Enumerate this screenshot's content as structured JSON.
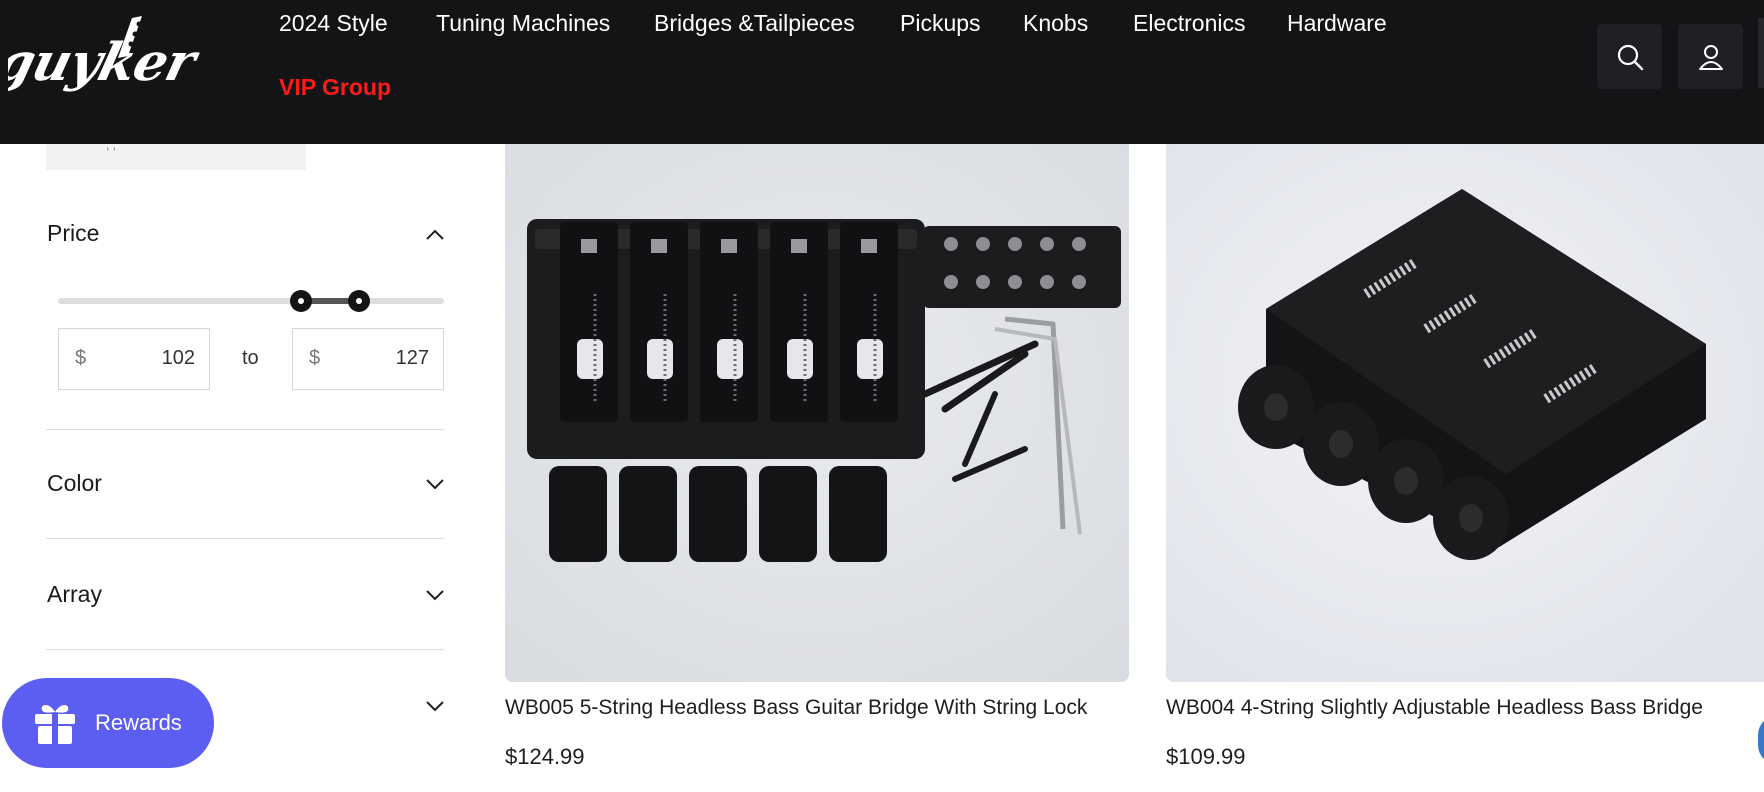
{
  "brand": {
    "logo_text": "guyker"
  },
  "nav": {
    "items": [
      {
        "label": "2024 Style"
      },
      {
        "label": "Tuning Machines"
      },
      {
        "label": "Bridges &Tailpieces"
      },
      {
        "label": "Pickups"
      },
      {
        "label": "Knobs"
      },
      {
        "label": "Electronics"
      },
      {
        "label": "Hardware"
      },
      {
        "label": "VIP Group"
      }
    ],
    "vip_color": "#ff1a1a"
  },
  "header_icons": {
    "search": "search-icon",
    "account": "user-icon"
  },
  "filters": {
    "price": {
      "title": "Price",
      "currency": "$",
      "min": "102",
      "max": "127",
      "to_label": "to",
      "range_low_fraction": 0.63,
      "range_high_fraction": 0.78
    },
    "facets": [
      {
        "title": "Color"
      },
      {
        "title": "Array"
      }
    ]
  },
  "rewards": {
    "label": "Rewards",
    "color": "#5b5ef0"
  },
  "products": [
    {
      "title": "WB005 5-String Headless Bass Guitar Bridge With String Lock",
      "price": "$124.99"
    },
    {
      "title": "WB004 4-String Slightly Adjustable Headless Bass Bridge",
      "price": "$109.99"
    }
  ],
  "colors": {
    "header_bg": "#131416",
    "accent": "#5b5ef0"
  }
}
